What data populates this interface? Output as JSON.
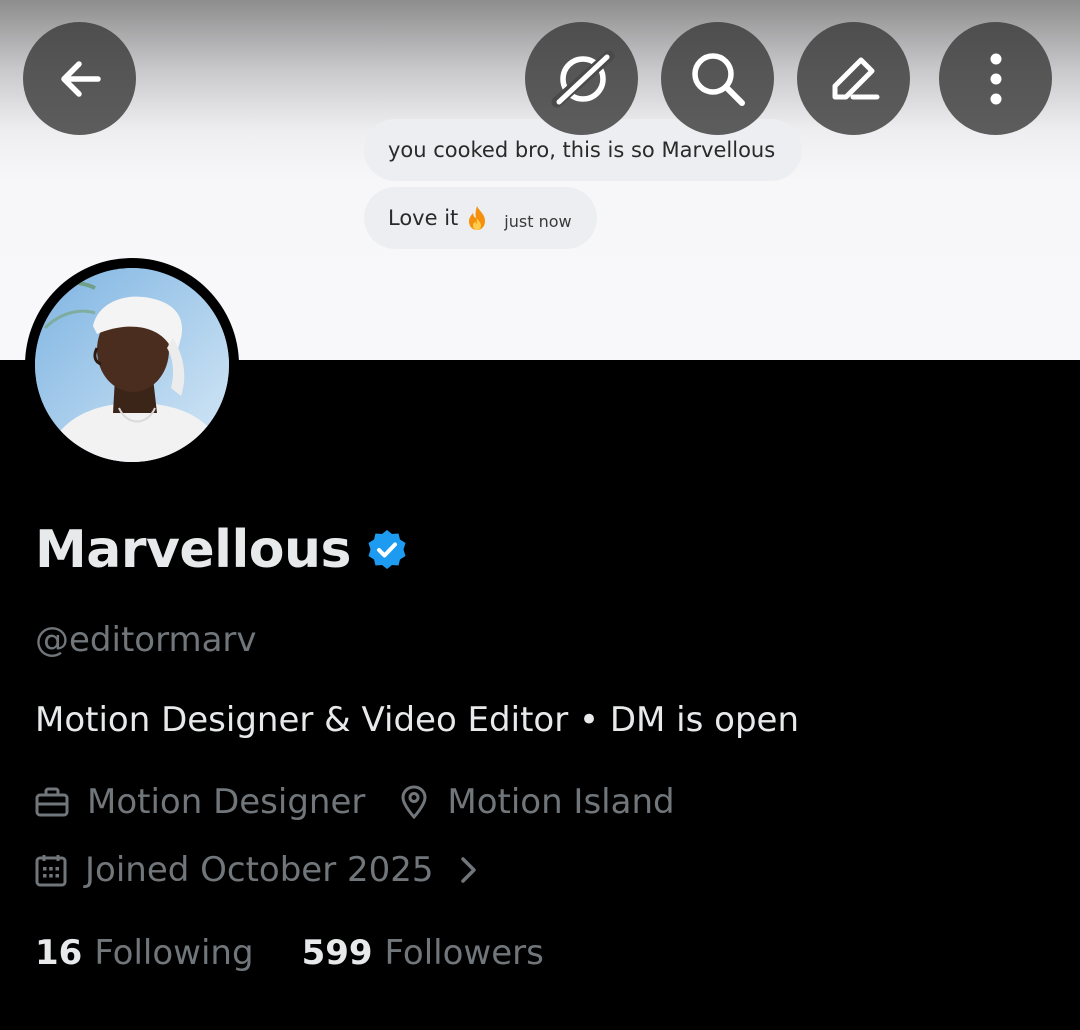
{
  "toolbar": {
    "back_icon": "arrow-left-icon",
    "grok_icon": "grok-icon",
    "search_icon": "search-icon",
    "edit_icon": "pencil-icon",
    "more_icon": "more-vertical-icon"
  },
  "banner": {
    "messages": [
      {
        "text": "you cooked bro, this is so Marvellous"
      },
      {
        "text": "Love it",
        "emoji": "🔥",
        "time": "just now"
      }
    ]
  },
  "profile": {
    "name": "Marvellous",
    "verified": true,
    "verified_color": "#1d9bf0",
    "handle": "@editormarv",
    "bio": "Motion Designer & Video Editor • DM is open",
    "profession": "Motion Designer",
    "location": "Motion Island",
    "joined": "Joined October 2025",
    "following_count": "16",
    "following_label": "Following",
    "followers_count": "599",
    "followers_label": "Followers"
  },
  "colors": {
    "background": "#000000",
    "primary_text": "#e7e9ea",
    "secondary_text": "#71767b",
    "accent": "#1d9bf0"
  }
}
